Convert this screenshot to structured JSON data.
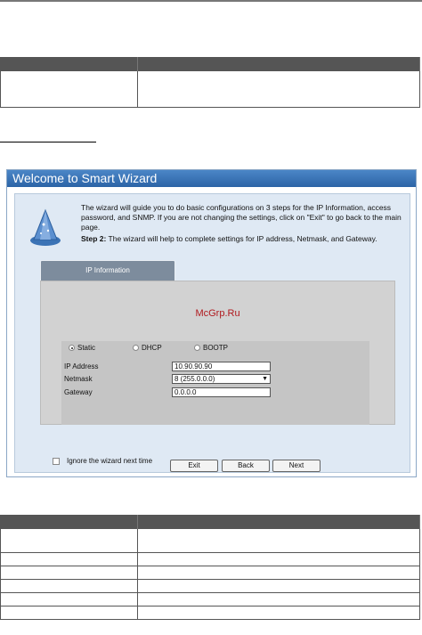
{
  "wizard": {
    "title": "Welcome to Smart Wizard",
    "intro": "The wizard will guide you to do basic configurations on 3 steps for the IP Information, access password, and SNMP. If you are not changing the settings, click on \"Exit\" to go back to the main page.",
    "step_label": "Step 2:",
    "step_text": " The wizard will help to complete settings for IP address, Netmask, and Gateway.",
    "tab_label": "IP Information",
    "watermark": "McGrp.Ru",
    "radios": [
      {
        "label": "Static",
        "selected": true
      },
      {
        "label": "DHCP",
        "selected": false
      },
      {
        "label": "BOOTP",
        "selected": false
      }
    ],
    "fields": {
      "ip_label": "IP Address",
      "ip_value": "10.90.90.90",
      "netmask_label": "Netmask",
      "netmask_value": "8 (255.0.0.0)",
      "gateway_label": "Gateway",
      "gateway_value": "0.0.0.0"
    },
    "ignore_label": "Ignore the wizard next time",
    "buttons": {
      "exit": "Exit",
      "back": "Back",
      "next": "Next"
    }
  },
  "colors": {
    "title_bar": "#2c64a6",
    "body_bg": "#dfe9f4",
    "panel_bg": "#d2d2d2"
  }
}
